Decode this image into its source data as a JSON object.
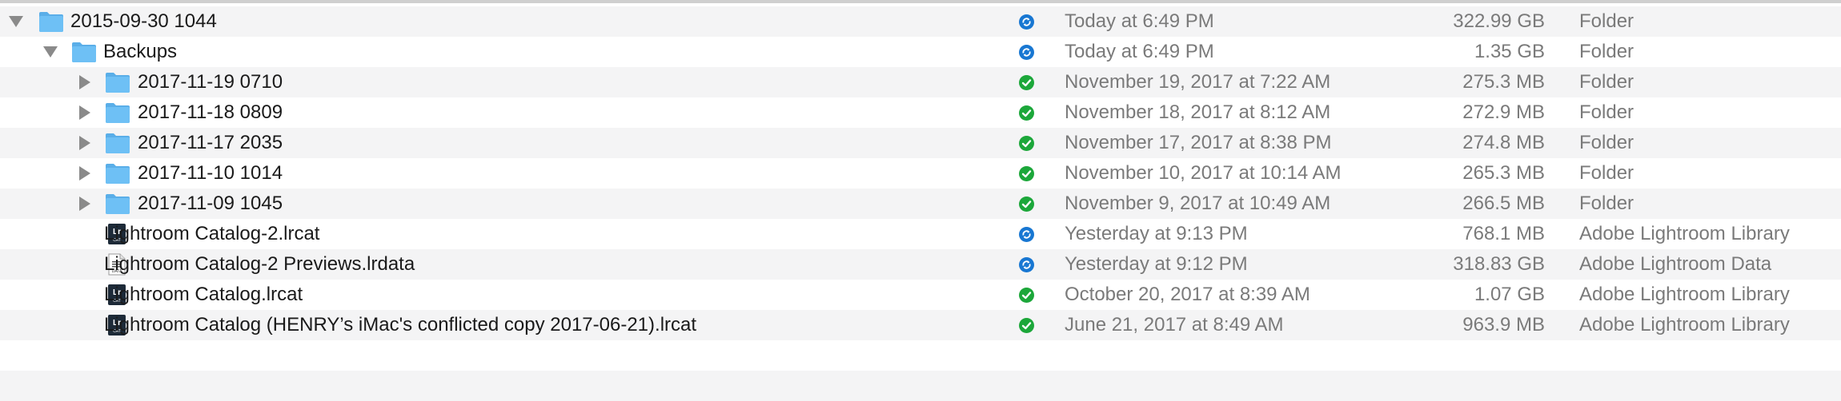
{
  "columns": [
    "name",
    "status",
    "date_modified",
    "size",
    "kind"
  ],
  "rows": [
    {
      "name": "2015-09-30 1044",
      "status": "syncing",
      "date": "Today at 6:49 PM",
      "size": "322.99 GB",
      "kind": "Folder",
      "icon": "folder-icon",
      "disclosure": "expanded",
      "level": 0
    },
    {
      "name": "Backups",
      "status": "syncing",
      "date": "Today at 6:49 PM",
      "size": "1.35 GB",
      "kind": "Folder",
      "icon": "folder-icon",
      "disclosure": "expanded",
      "level": 1
    },
    {
      "name": "2017-11-19 0710",
      "status": "synced",
      "date": "November 19, 2017 at 7:22 AM",
      "size": "275.3 MB",
      "kind": "Folder",
      "icon": "folder-icon",
      "disclosure": "collapsed",
      "level": 2
    },
    {
      "name": "2017-11-18 0809",
      "status": "synced",
      "date": "November 18, 2017 at 8:12 AM",
      "size": "272.9 MB",
      "kind": "Folder",
      "icon": "folder-icon",
      "disclosure": "collapsed",
      "level": 2
    },
    {
      "name": "2017-11-17 2035",
      "status": "synced",
      "date": "November 17, 2017 at 8:38 PM",
      "size": "274.8 MB",
      "kind": "Folder",
      "icon": "folder-icon",
      "disclosure": "collapsed",
      "level": 2
    },
    {
      "name": "2017-11-10 1014",
      "status": "synced",
      "date": "November 10, 2017 at 10:14 AM",
      "size": "265.3 MB",
      "kind": "Folder",
      "icon": "folder-icon",
      "disclosure": "collapsed",
      "level": 2
    },
    {
      "name": "2017-11-09 1045",
      "status": "synced",
      "date": "November 9, 2017 at 10:49 AM",
      "size": "266.5 MB",
      "kind": "Folder",
      "icon": "folder-icon",
      "disclosure": "collapsed",
      "level": 2
    },
    {
      "name": "Lightroom Catalog-2.lrcat",
      "status": "syncing",
      "date": "Yesterday at 9:13 PM",
      "size": "768.1 MB",
      "kind": "Adobe Lightroom Library",
      "icon": "lightroom-catalog-icon",
      "disclosure": "none",
      "level": 1
    },
    {
      "name": "Lightroom Catalog-2 Previews.lrdata",
      "status": "syncing",
      "date": "Yesterday at 9:12 PM",
      "size": "318.83 GB",
      "kind": "Adobe Lightroom Data",
      "icon": "lightroom-data-icon",
      "disclosure": "none",
      "level": 1
    },
    {
      "name": "Lightroom Catalog.lrcat",
      "status": "synced",
      "date": "October 20, 2017 at 8:39 AM",
      "size": "1.07 GB",
      "kind": "Adobe Lightroom Library",
      "icon": "lightroom-catalog-icon",
      "disclosure": "none",
      "level": 1
    },
    {
      "name": "Lightroom Catalog (HENRY’s iMac's conflicted copy 2017-06-21).lrcat",
      "status": "synced",
      "date": "June 21, 2017 at 8:49 AM",
      "size": "963.9 MB",
      "kind": "Adobe Lightroom Library",
      "icon": "lightroom-catalog-icon",
      "disclosure": "none",
      "level": 1
    }
  ],
  "icon_text": {
    "lr": "Lr",
    "cat": "CAT",
    "data": "DATA"
  },
  "colors": {
    "folder": "#6ec0f5",
    "folder_tab": "#5aaee8",
    "synced": "#1ca73a",
    "syncing": "#1877d2",
    "row_alt": "#f4f4f5",
    "meta_text": "#7a7a7a",
    "lightroom_icon": "#1d2a38"
  }
}
